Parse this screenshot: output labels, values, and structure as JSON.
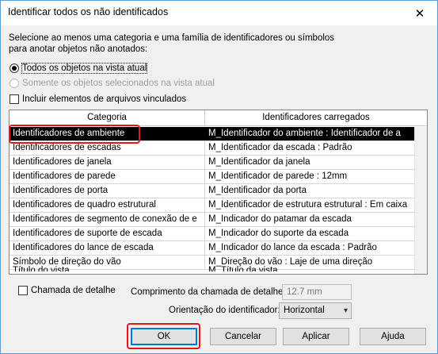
{
  "window": {
    "title": "Identificar todos os não identificados",
    "close_glyph": "✕"
  },
  "instructions": {
    "line1": "Selecione ao menos uma categoria e uma família de identificadores ou símbolos",
    "line2": "para anotar objetos não anotados:"
  },
  "options": {
    "all_objects": "Todos os objetos na vista atual",
    "selected_only": "Somente os objetos selecionados na vista atual",
    "linked_files": "Incluir elementos de arquivos vinculados"
  },
  "table": {
    "headers": [
      "Categoria",
      "Identificadores carregados"
    ],
    "rows": [
      [
        "Identificadores de ambiente",
        "M_Identificador do ambiente : Identificador de a"
      ],
      [
        "Identificadores de escadas",
        "M_Identificador da escada : Padrão"
      ],
      [
        "Identificadores de janela",
        "M_Identificador da janela"
      ],
      [
        "Identificadores de parede",
        "M_Identificador de parede : 12mm"
      ],
      [
        "Identificadores de porta",
        "M_Identificador da porta"
      ],
      [
        "Identificadores de quadro estrutural",
        "M_Identificador de estrutura estrutural : Em caixa"
      ],
      [
        "Identificadores de segmento de conexão de e",
        "M_Indicador do patamar da escada"
      ],
      [
        "Identificadores de suporte de escada",
        "M_Indicador do suporte da escada"
      ],
      [
        "Identificadores do lance de escada",
        "M_Indicador do lance da escada : Padrão"
      ],
      [
        "Símbolo de direção do vão",
        "M_Direção do vão : Laje de uma direção"
      ]
    ],
    "partial_row": [
      "Título do vista",
      "M_Título da vista"
    ]
  },
  "detail": {
    "callout_label": "Chamada de detalhe",
    "length_label": "Comprimento da chamada de detalhe:",
    "length_value": "12.7 mm",
    "orientation_label": "Orientação do identificador:",
    "orientation_value": "Horizontal"
  },
  "buttons": {
    "ok": "OK",
    "cancel": "Cancelar",
    "apply": "Aplicar",
    "help": "Ajuda"
  },
  "colors": {
    "highlight": "#e3161c",
    "selection": "#000000",
    "accent": "#0078d7"
  }
}
